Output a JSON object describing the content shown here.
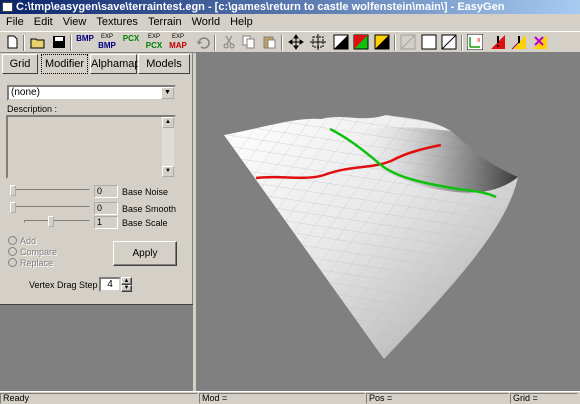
{
  "window": {
    "title": "C:\\tmp\\easygen\\save\\terraintest.egn - [c:\\games\\return to castle wolfenstein\\main\\] - EasyGen"
  },
  "menu": [
    "File",
    "Edit",
    "View",
    "Textures",
    "Terrain",
    "World",
    "Help"
  ],
  "toolbar": {
    "bmp_import": {
      "top": "",
      "bottom": "BMP"
    },
    "bmp_export": {
      "top": "EXP",
      "bottom": "BMP"
    },
    "pcx_import": {
      "top": "",
      "bottom": "PCX"
    },
    "pcx_export": {
      "top": "EXP",
      "bottom": "PCX"
    },
    "map_export": {
      "top": "EXP",
      "bottom": "MAP"
    }
  },
  "tabs": [
    "Grid",
    "Modifier",
    "Alphamap",
    "Models"
  ],
  "modifier": {
    "selected": "(none)",
    "description_label": "Description :",
    "sliders": [
      {
        "label": "Base Noise",
        "value": "0",
        "position": 0.0
      },
      {
        "label": "Base Smooth",
        "value": "0",
        "position": 0.0
      },
      {
        "label": "Base Scale",
        "value": "1",
        "position": 0.5
      }
    ],
    "radios": [
      "Add",
      "Compare",
      "Replace"
    ],
    "apply_label": "Apply",
    "vertex_drag_label": "Vertex Drag Step",
    "vertex_drag_value": "4"
  },
  "status": {
    "ready": "Ready",
    "mod": "Mod =",
    "pos": "Pos =",
    "grid": "Grid ="
  },
  "colors": {
    "red_line": "#e01010",
    "green_line": "#10c010",
    "viewport_bg": "#808080"
  }
}
